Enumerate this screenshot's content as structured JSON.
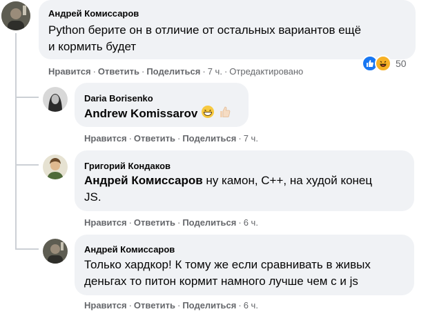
{
  "actions": {
    "like": "Нравится",
    "reply": "Ответить",
    "share": "Поделиться",
    "sep": "·"
  },
  "comments": [
    {
      "author": "Андрей Комиссаров",
      "text_line1": "Python берите он в отличие от остальных вариантов ещё",
      "text_line2": "и кормить будет",
      "time": "7 ч.",
      "edited": "Отредактировано",
      "reactions_count": "50",
      "reaction_icons": [
        "like-icon",
        "haha-icon"
      ]
    },
    {
      "author": "Daria Borisenko",
      "mention": "Andrew Komissarov",
      "emojis": [
        "grinning-face-icon",
        "thumbs-up-icon"
      ],
      "time": "7 ч."
    },
    {
      "author": "Григорий Кондаков",
      "mention": "Андрей Комиссаров",
      "text_line1": " ну камон, С++, на худой конец",
      "text_line2": "JS.",
      "time": "6 ч."
    },
    {
      "author": "Андрей Комиссаров",
      "text_line1": "Только хардкор! К тому же если сравнивать в живых",
      "text_line2": "деньгах то питон кормит намного лучше чем с и js",
      "time": "6 ч."
    }
  ],
  "colors": {
    "bubble": "#f0f2f5",
    "meta": "#65676b",
    "like_blue": "#1877f2",
    "haha_yellow": "#f7b125"
  }
}
